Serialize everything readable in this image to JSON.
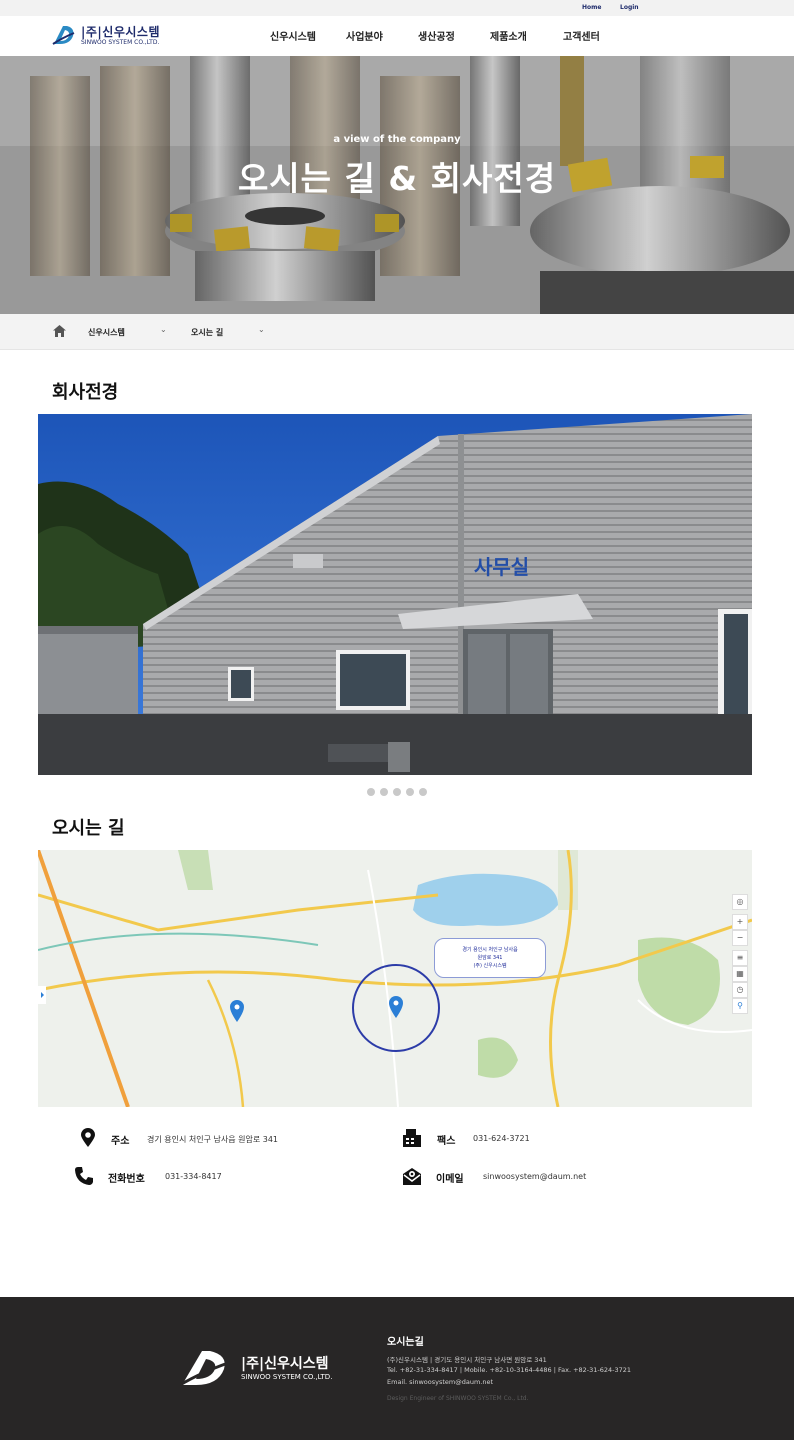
{
  "topbar": {
    "home": "Home",
    "login": "Login"
  },
  "header": {
    "logo_kr": "|주|신우시스템",
    "logo_en": "SINWOO SYSTEM CO.,LTD.",
    "nav": [
      "신우시스템",
      "사업분야",
      "생산공정",
      "제품소개",
      "고객센터"
    ]
  },
  "hero": {
    "subtitle": "a view of the company",
    "title": "오시는 길 & 회사전경"
  },
  "breadcrumb": {
    "level1": "신우시스템",
    "level2": "오시는 길"
  },
  "sections": {
    "company_view": "회사전경",
    "directions": "오시는 길"
  },
  "photo": {
    "sign_text": "사무실"
  },
  "slider": {
    "count": 5,
    "active": 0
  },
  "map": {
    "tooltip_line1": "경기 용인시 처인구 남사읍",
    "tooltip_line2": "원암로 341",
    "tooltip_line3": "(주) 신우시스템"
  },
  "contact": {
    "address_label": "주소",
    "address_value": "경기 용인시 처인구 남사읍 원암로 341",
    "fax_label": "팩스",
    "fax_value": "031-624-3721",
    "phone_label": "전화번호",
    "phone_value": "031-334-8417",
    "email_label": "이메일",
    "email_value": "sinwoosystem@daum.net"
  },
  "footer": {
    "logo_kr": "|주|신우시스템",
    "logo_en": "SINWOO SYSTEM CO.,LTD.",
    "title": "오시는길",
    "line1": "(주)신우시스템    |    경기도 용인시 처인구 남사면 원암로 341",
    "line2": "Tel. +82-31-334-8417    |    Mobile. +82-10-3164-4486    |    Fax. +82-31-624-3721",
    "line3": "Email. sinwoosystem@daum.net",
    "copyright": "Design Engineer of SHINWOO SYSTEM Co., Ltd."
  },
  "colors": {
    "brand": "#1e2b6b",
    "footer_bg": "#282626",
    "map_pin": "#2b7fd6",
    "map_circle": "#2c3ca8"
  }
}
